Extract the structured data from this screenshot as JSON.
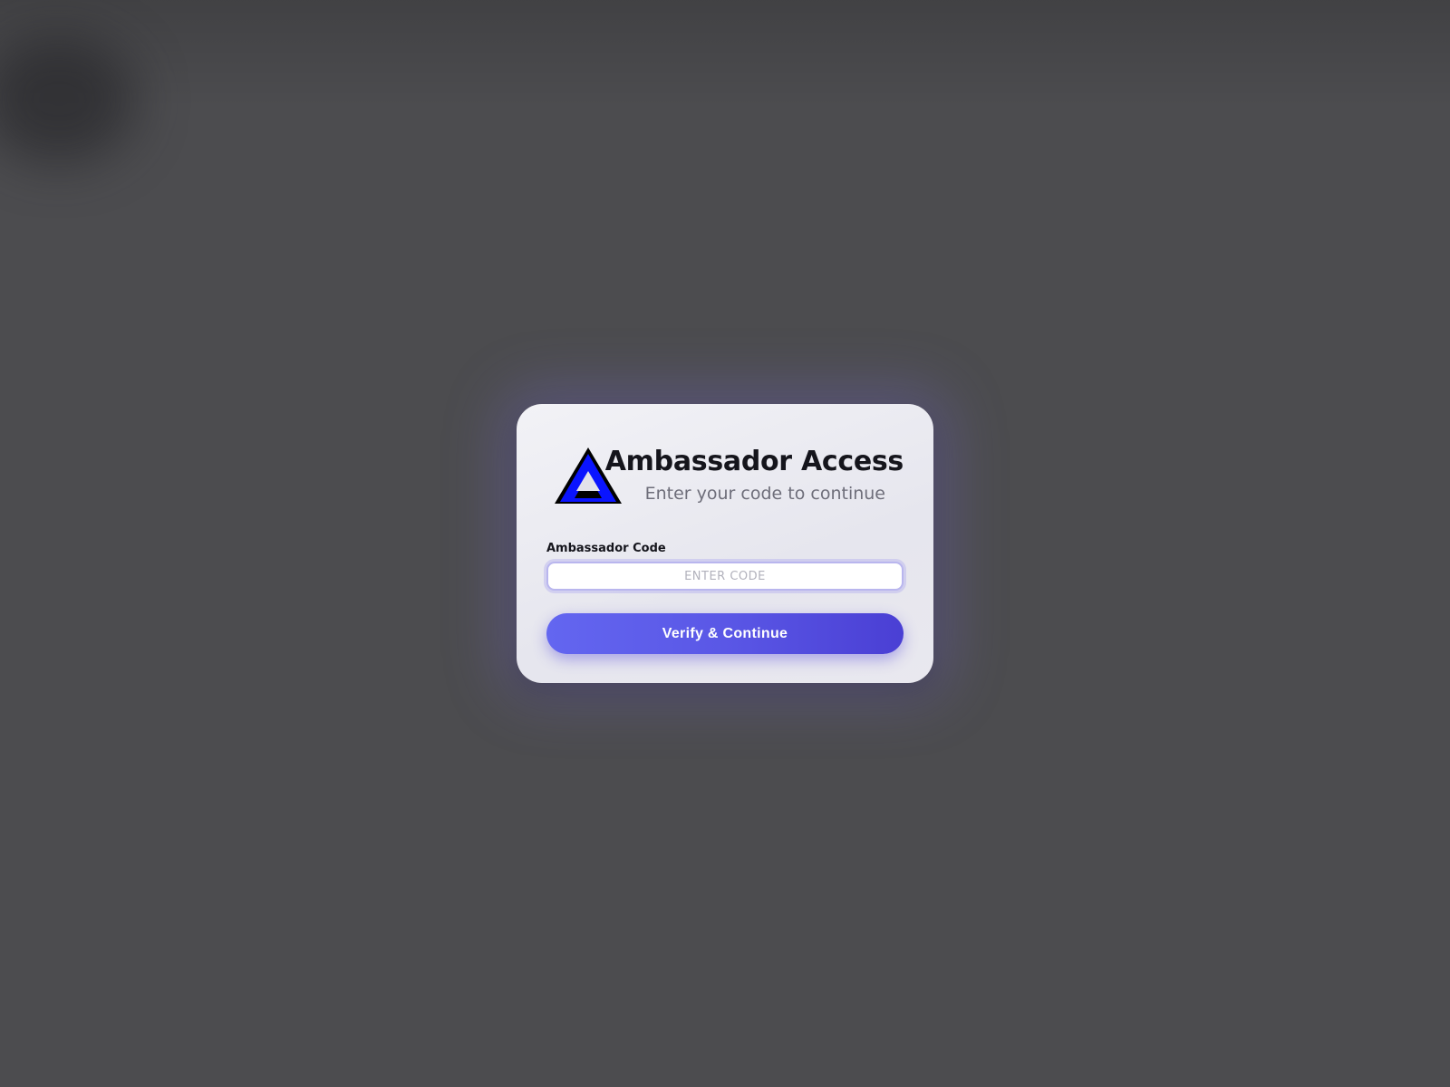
{
  "page": {
    "background_color": "#4c4c4f"
  },
  "login_card": {
    "logo_icon": "triangle-logo-icon",
    "title": "Ambassador Access",
    "subtitle": "Enter your code to continue",
    "code_field": {
      "label": "Ambassador Code",
      "placeholder": "ENTER CODE",
      "value": ""
    },
    "submit_button": {
      "label": "Verify & Continue"
    },
    "colors": {
      "accent": "#5b5be8",
      "logo_blue": "#0a14ff",
      "logo_outline": "#000000"
    }
  }
}
